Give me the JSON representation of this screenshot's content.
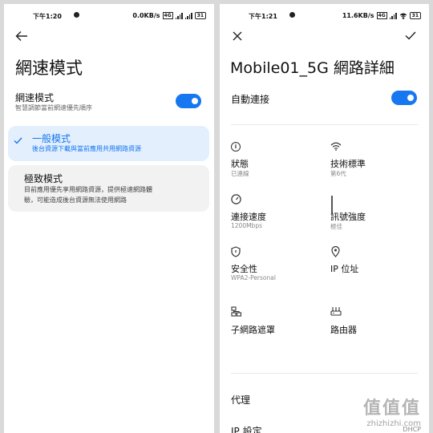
{
  "left": {
    "status": {
      "time": "下午1:20",
      "net_speed": "0.0KB/s",
      "battery": "31"
    },
    "title": "網速模式",
    "net_speed_mode": {
      "label": "網速模式",
      "sub": "智慧調節當前網速優先順序",
      "enabled": true
    },
    "options": [
      {
        "title": "一般模式",
        "desc": "後台資源下載與當前應用共用網路資源",
        "selected": true
      },
      {
        "title": "極致模式",
        "desc_line1": "目前應用優先享用網路資源，提供極速網路體",
        "desc_line2": "驗，可能造成後台資源無法使用網路",
        "selected": false
      }
    ]
  },
  "right": {
    "status": {
      "time": "下午1:21",
      "net_speed": "11.6KB/s",
      "battery": "31"
    },
    "title": "Mobile01_5G 網路詳細",
    "auto_connect": {
      "label": "自動連接",
      "enabled": true
    },
    "details": {
      "status": {
        "label": "狀態",
        "value": "已連線",
        "icon": "info-icon"
      },
      "standard": {
        "label": "技術標準",
        "value": "第6代",
        "icon": "wifi-icon"
      },
      "speed": {
        "label": "連接速度",
        "value": "1200Mbps",
        "icon": "speedometer-icon"
      },
      "signal": {
        "label": "訊號強度",
        "value": "極佳",
        "icon": "signal-icon"
      },
      "security": {
        "label": "安全性",
        "value": "WPA2-Personal",
        "icon": "shield-icon"
      },
      "ip": {
        "label": "IP 位址",
        "value": "",
        "icon": "location-pin-icon"
      },
      "subnet": {
        "label": "子網路遮罩",
        "value": "",
        "icon": "network-icon"
      },
      "router": {
        "label": "路由器",
        "value": "",
        "icon": "router-icon"
      }
    },
    "proxy": {
      "label": "代理"
    },
    "ip_settings": {
      "label": "IP 設定",
      "value": "DHCP"
    }
  },
  "watermark": {
    "big": "值值值",
    "small": "zhizhizhi.com"
  },
  "colors": {
    "accent": "#1677f0",
    "background": "#d9d9d9",
    "card_selected": "#e3effd",
    "card_unselected": "#f2f2f2"
  }
}
